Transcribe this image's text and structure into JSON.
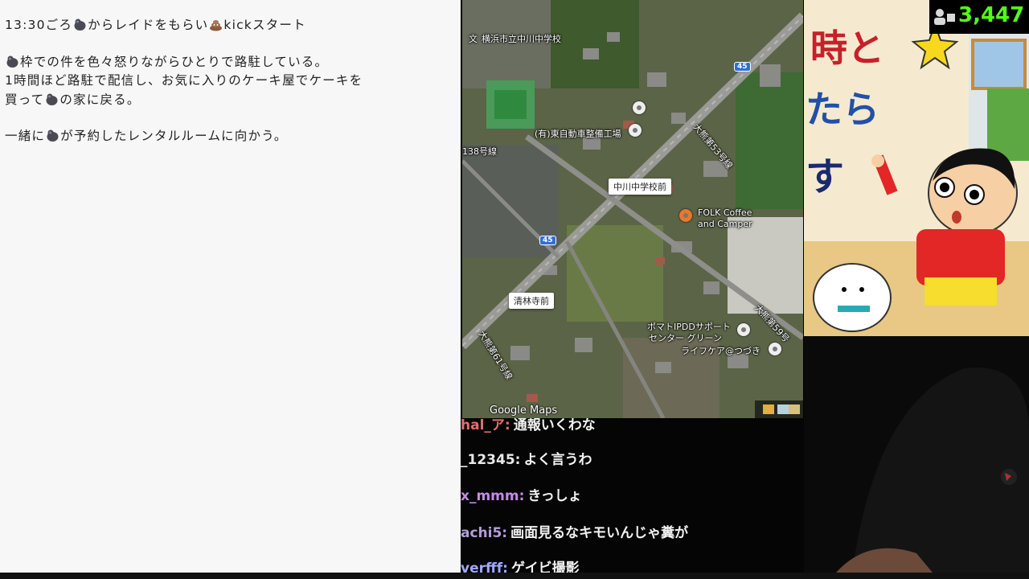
{
  "notes": {
    "lines": [
      {
        "parts": [
          "13:30ごろ",
          "gorilla-emoji",
          "からレイドをもらい",
          "poop-emoji",
          "kickスタート"
        ]
      },
      {
        "parts": [
          "gorilla-emoji",
          "枠での件を色々怒りながらひとりで路駐している。"
        ]
      },
      {
        "parts": [
          "1時間ほど路駐で配信し、お気に入りのケーキ屋でケーキを"
        ]
      },
      {
        "parts": [
          "買って",
          "gorilla-emoji",
          "の家に戻る。"
        ]
      },
      {
        "parts": [
          "一緒に",
          "gorilla-emoji",
          "が予約したレンタルルームに向かう。"
        ]
      }
    ]
  },
  "map": {
    "labels": {
      "school": "横浜市立中川中学校",
      "repair": "(有)東自動車整備工場",
      "intersection1": "中川中学校前",
      "cafe_line1": "FOLK Coffee",
      "cafe_line2": "and Camper",
      "intersection2": "清林寺前",
      "support_line1": "ポマトIPDDサポート",
      "support_line2": "センター グリーン",
      "lifecare": "ライフケア@つづき",
      "road_53": "大熊第53号線",
      "road_61": "大熊第61号線",
      "road_59": "大熊第59号",
      "road_138": "138号線",
      "route_45": "45",
      "brand": "Google Maps"
    }
  },
  "chat": {
    "messages": [
      {
        "user": "hal_ア:",
        "text": "通報いくわな",
        "user_color": "#e86d6d"
      },
      {
        "user": "_12345:",
        "text": "よく言うわ",
        "user_color": "#e8e8e8"
      },
      {
        "user": "x_mmm:",
        "text": "きっしょ",
        "user_color": "#c58be6"
      },
      {
        "user": "achi5:",
        "text": "画面見るなキモいんじゃ糞が",
        "user_color": "#b39ddb"
      },
      {
        "user": "verfff:",
        "text": "ゲイビ撮影",
        "user_color": "#9fa8ff"
      }
    ]
  },
  "stream": {
    "viewer_count": "3,447",
    "art_text": [
      "時と",
      "たら",
      "す"
    ]
  },
  "colors": {
    "viewer_green": "#53fc18",
    "notes_bg": "#f7f7f7",
    "chat_bg": "#050505"
  }
}
